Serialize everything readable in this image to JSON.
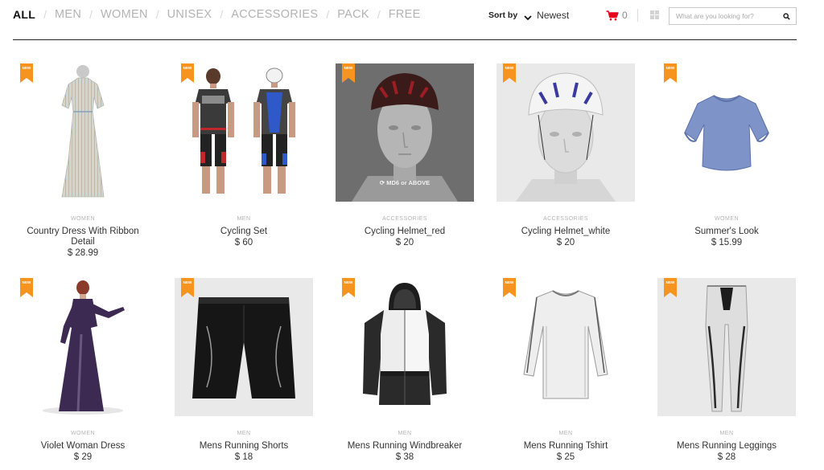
{
  "nav": {
    "categories": [
      {
        "label": "ALL"
      },
      {
        "label": "MEN"
      },
      {
        "label": "WOMEN"
      },
      {
        "label": "UNISEX"
      },
      {
        "label": "ACCESSORIES"
      },
      {
        "label": "PACK"
      },
      {
        "label": "FREE"
      }
    ],
    "separator": "/"
  },
  "sort": {
    "label": "Sort by",
    "value": "Newest"
  },
  "cart": {
    "count": "0"
  },
  "search": {
    "placeholder": "What are you looking for?"
  },
  "badge": "NEW",
  "products": [
    {
      "category": "WOMEN",
      "name": "Country Dress With Ribbon Detail",
      "price": "$ 28.99",
      "badge": "NEW"
    },
    {
      "category": "MEN",
      "name": "Cycling Set",
      "price": "$ 60",
      "badge": "NEW"
    },
    {
      "category": "ACCESSORIES",
      "name": "Cycling Helmet_red",
      "price": "$ 20",
      "badge": "NEW",
      "overlay": "MD6 or ABOVE"
    },
    {
      "category": "ACCESSORIES",
      "name": "Cycling Helmet_white",
      "price": "$ 20",
      "badge": "NEW"
    },
    {
      "category": "WOMEN",
      "name": "Summer's Look",
      "price": "$ 15.99",
      "badge": "NEW"
    },
    {
      "category": "WOMEN",
      "name": "Violet Woman Dress",
      "price": "$ 29",
      "badge": "NEW"
    },
    {
      "category": "MEN",
      "name": "Mens Running Shorts",
      "price": "$ 18",
      "badge": "NEW"
    },
    {
      "category": "MEN",
      "name": "Mens Running Windbreaker",
      "price": "$ 38",
      "badge": "NEW"
    },
    {
      "category": "MEN",
      "name": "Mens Running Tshirt",
      "price": "$ 25",
      "badge": "NEW"
    },
    {
      "category": "MEN",
      "name": "Mens Running Leggings",
      "price": "$ 28",
      "badge": "NEW"
    }
  ],
  "colors": {
    "accent": "#f7941d",
    "cart": "#e8001c",
    "text": "#333333",
    "muted": "#b3b3b3"
  }
}
